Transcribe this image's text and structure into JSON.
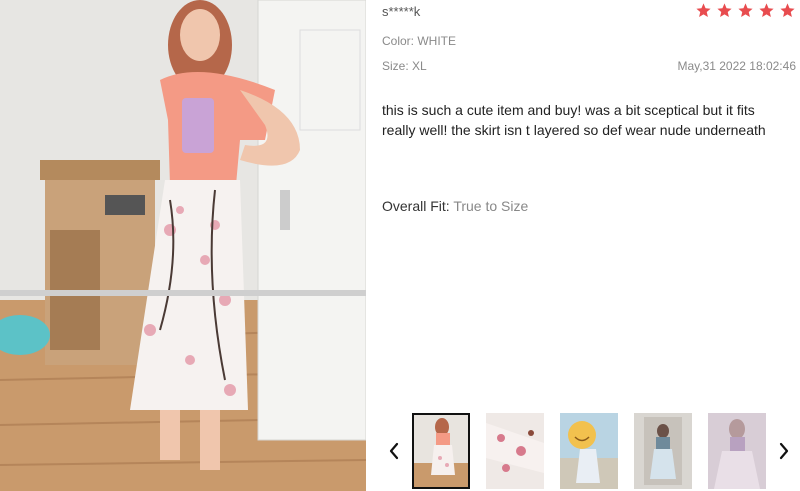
{
  "review": {
    "reviewer_name": "s*****k",
    "rating": 5,
    "star_color": "#e84c4f",
    "color_label": "Color: WHITE",
    "size_label": "Size: XL",
    "date": "May,31 2022 18:02:46",
    "text": "this is such a cute item and buy! was a bit sceptical but it fits really well! the skirt isn t layered so def wear nude underneath",
    "fit_label": "Overall Fit:",
    "fit_value": "True to Size"
  },
  "carousel": {
    "prev_icon": "chevron-left-icon",
    "next_icon": "chevron-right-icon",
    "thumbnails": [
      {
        "name": "thumbnail-1",
        "active": true
      },
      {
        "name": "thumbnail-2",
        "active": false
      },
      {
        "name": "thumbnail-3",
        "active": false
      },
      {
        "name": "thumbnail-4",
        "active": false
      },
      {
        "name": "thumbnail-5",
        "active": false
      }
    ]
  }
}
